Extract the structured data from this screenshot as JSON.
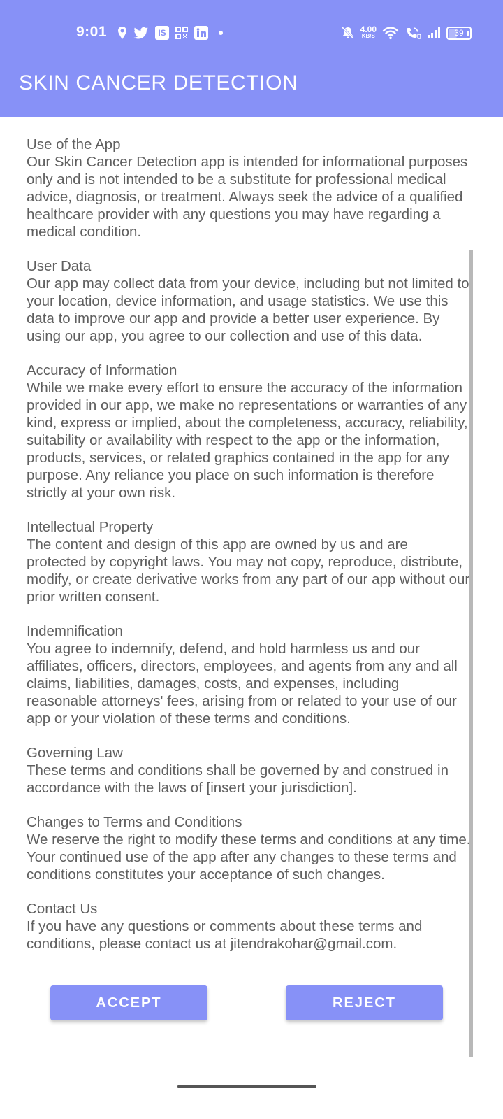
{
  "status_bar": {
    "time": "9:01",
    "net_speed_value": "4.00",
    "net_speed_unit": "KB/S",
    "battery_level": "39",
    "left_icons": [
      "location-icon",
      "twitter-icon",
      "is-app-icon",
      "qr-icon",
      "linkedin-icon",
      "dot-icon"
    ],
    "right_icons": [
      "mute-bell-icon",
      "net-speed",
      "wifi-icon",
      "wifi-call-icon",
      "signal-icon",
      "battery-icon"
    ]
  },
  "app_bar": {
    "title": "SKIN CANCER DETECTION"
  },
  "terms": [
    {
      "heading": "Use of the App",
      "body": "Our Skin Cancer Detection app is intended for informational purposes only and is not intended to be a substitute for professional medical advice, diagnosis, or treatment. Always seek the advice of a qualified healthcare provider with any questions you may have regarding a medical condition."
    },
    {
      "heading": "User Data",
      "body": "Our app may collect data from your device, including but not limited to your location, device information, and usage statistics. We use this data to improve our app and provide a better user experience. By using our app, you agree to our collection and use of this data."
    },
    {
      "heading": "Accuracy of Information",
      "body": "While we make every effort to ensure the accuracy of the information provided in our app, we make no representations or warranties of any kind, express or implied, about the completeness, accuracy, reliability, suitability or availability with respect to the app or the information, products, services, or related graphics contained in the app for any purpose. Any reliance you place on such information is therefore strictly at your own risk."
    },
    {
      "heading": "Intellectual Property",
      "body": "The content and design of this app are owned by us and are protected by copyright laws. You may not copy, reproduce, distribute, modify, or create derivative works from any part of our app without our prior written consent."
    },
    {
      "heading": "Indemnification",
      "body": "You agree to indemnify, defend, and hold harmless us and our affiliates, officers, directors, employees, and agents from any and all claims, liabilities, damages, costs, and expenses, including reasonable attorneys' fees, arising from or related to your use of our app or your violation of these terms and conditions."
    },
    {
      "heading": "Governing Law",
      "body": "These terms and conditions shall be governed by and construed in accordance with the laws of [insert your jurisdiction]."
    },
    {
      "heading": "Changes to Terms and Conditions",
      "body": "We reserve the right to modify these terms and conditions at any time. Your continued use of the app after any changes to these terms and conditions constitutes your acceptance of such changes."
    },
    {
      "heading": "Contact Us",
      "body": "If you have any questions or comments about these terms and conditions, please contact us at jitendrakohar@gmail.com."
    }
  ],
  "actions": {
    "accept_label": "ACCEPT",
    "reject_label": "REJECT"
  },
  "colors": {
    "primary": "#8791f7",
    "text": "#5f5f5f",
    "background": "#ffffff",
    "scrollbar": "#b8b8b8"
  }
}
